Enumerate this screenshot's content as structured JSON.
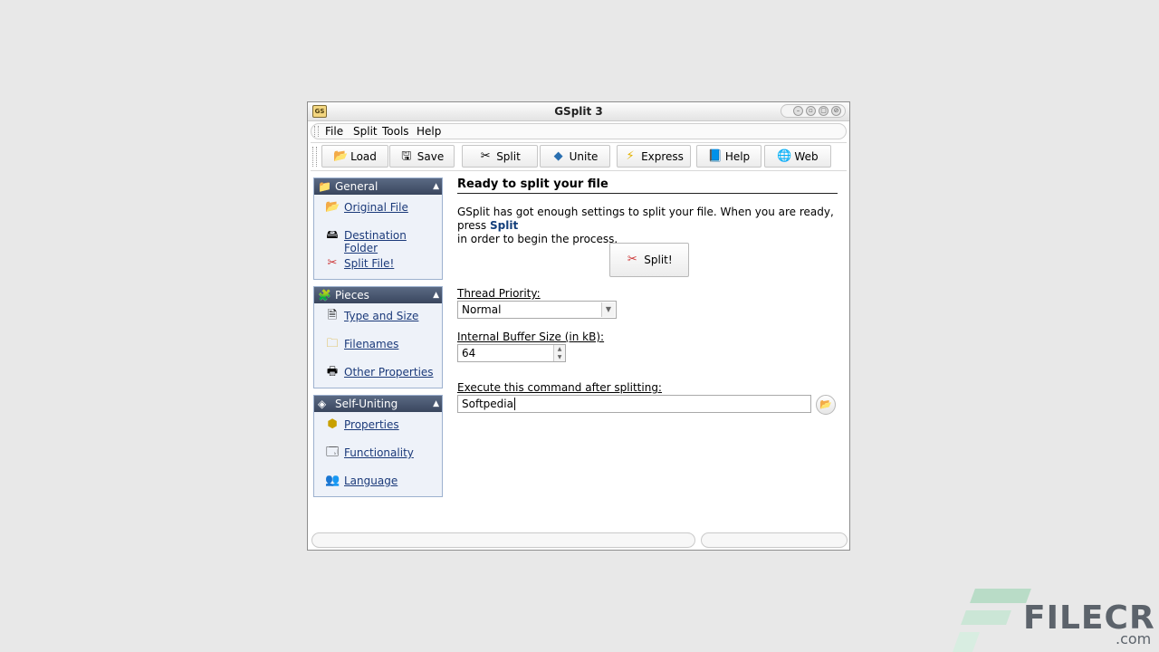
{
  "window": {
    "title": "GSplit 3"
  },
  "menu": {
    "items": [
      {
        "label": "File"
      },
      {
        "label": "Split"
      },
      {
        "label": "Tools"
      },
      {
        "label": "Help"
      }
    ]
  },
  "toolbar": {
    "buttons": [
      {
        "label": "Load",
        "icon": "folder-open-icon"
      },
      {
        "label": "Save",
        "icon": "save-icon"
      },
      {
        "label": "Split",
        "icon": "split-icon"
      },
      {
        "label": "Unite",
        "icon": "unite-icon"
      },
      {
        "label": "Express",
        "icon": "lightning-icon"
      },
      {
        "label": "Help",
        "icon": "help-book-icon"
      },
      {
        "label": "Web",
        "icon": "globe-icon"
      }
    ]
  },
  "sidebar": {
    "panels": [
      {
        "title": "General",
        "items": [
          {
            "label": "Original File",
            "icon": "original-file-icon"
          },
          {
            "label": "Destination Folder",
            "icon": "destination-folder-icon"
          },
          {
            "label": "Split File!",
            "icon": "scissors-icon"
          }
        ]
      },
      {
        "title": "Pieces",
        "items": [
          {
            "label": "Type and Size",
            "icon": "type-size-icon"
          },
          {
            "label": "Filenames",
            "icon": "filenames-icon"
          },
          {
            "label": "Other Properties",
            "icon": "other-properties-icon"
          }
        ]
      },
      {
        "title": "Self-Uniting",
        "items": [
          {
            "label": "Properties",
            "icon": "properties-icon"
          },
          {
            "label": "Functionality",
            "icon": "functionality-icon"
          },
          {
            "label": "Language",
            "icon": "language-icon"
          }
        ]
      }
    ]
  },
  "main": {
    "heading": "Ready to split your file",
    "description_part1": "GSplit has got enough settings to split your file. When you are ready, press ",
    "description_bold": "Split",
    "description_part2": "in order to begin the process.",
    "split_button": "Split!",
    "thread_priority_label": "Thread Priority:",
    "thread_priority_value": "Normal",
    "buffer_label": "Internal Buffer Size (in kB):",
    "buffer_value": "64",
    "command_label": "Execute this command after splitting:",
    "command_value": "Softpedia"
  },
  "watermark": {
    "text": "FILECR",
    "suffix": ".com"
  }
}
